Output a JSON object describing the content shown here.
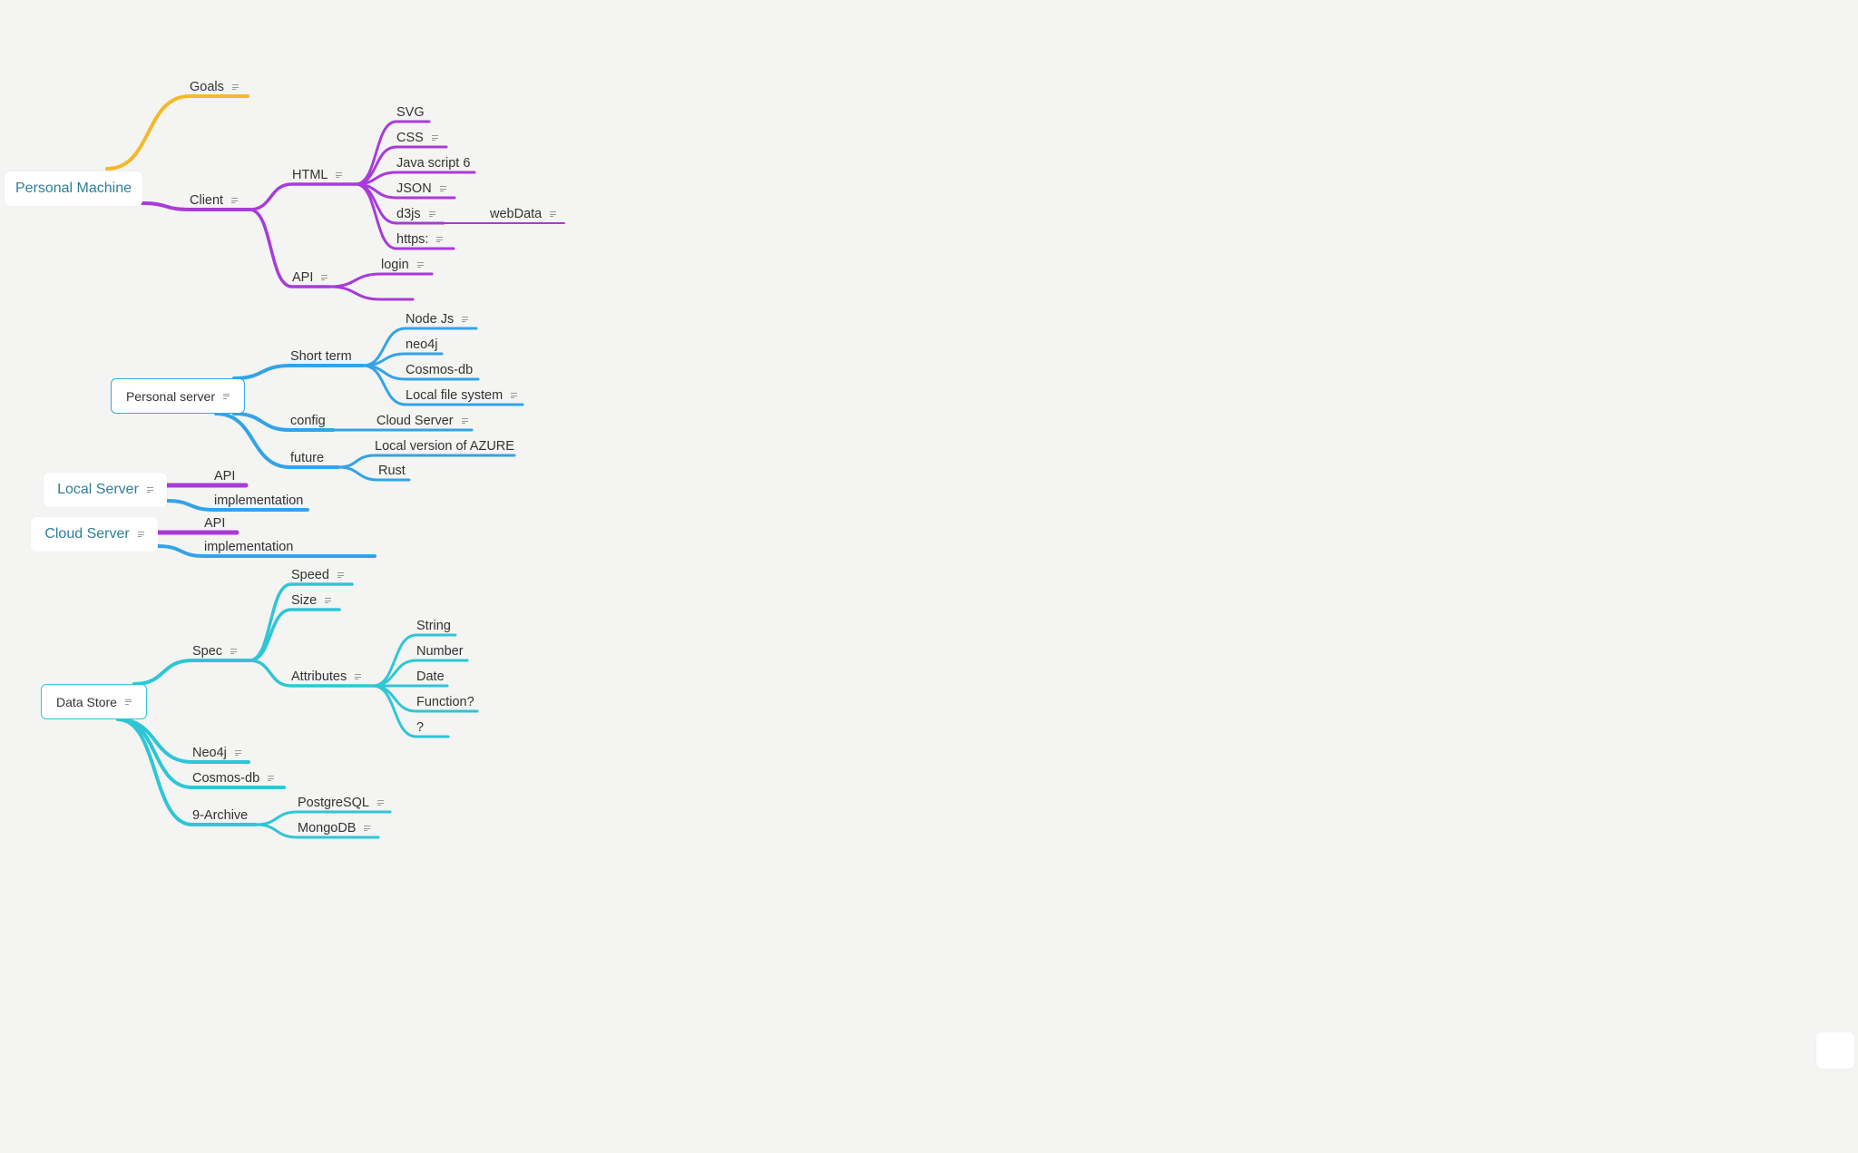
{
  "colors": {
    "yellow": "#f4b92a",
    "purple": "#a83bd9",
    "blue": "#33a3e8",
    "teal": "#2ec6d6"
  },
  "roots": {
    "personal_machine": "Personal Machine",
    "personal_server": "Personal server",
    "local_server": "Local Server",
    "cloud_server": "Cloud Server",
    "data_store": "Data Store"
  },
  "topics": {
    "goals": "Goals",
    "client": "Client",
    "html": "HTML",
    "svg": "SVG",
    "css": "CSS",
    "javascript": "Java script 6",
    "json": "JSON",
    "d3js": "d3js",
    "webdata": "webData",
    "https": "https:",
    "api": "API",
    "login": "login",
    "short_term": "Short term",
    "node_js": "Node Js",
    "neo4j_lower": "neo4j",
    "cosmos_db": "Cosmos-db",
    "local_file_system": "Local file system",
    "config": "config",
    "cloud_server_child": "Cloud Server",
    "future": "future",
    "local_azure": "Local version of AZURE",
    "rust": "Rust",
    "local_api": "API",
    "local_implementation": "implementation",
    "cloud_api": "API",
    "cloud_implementation": "implementation",
    "spec": "Spec",
    "speed": "Speed",
    "size": "Size",
    "attributes": "Attributes",
    "string": "String",
    "number": "Number",
    "date": "Date",
    "function": "Function?",
    "question": "?",
    "neo4j": "Neo4j",
    "cosmos_db_store": "Cosmos-db",
    "archive": "9-Archive",
    "postgresql": "PostgreSQL",
    "mongodb": "MongoDB"
  }
}
